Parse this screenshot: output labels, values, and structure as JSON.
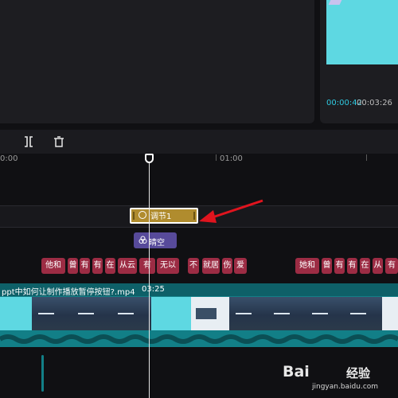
{
  "preview": {
    "current_time": "00:00:42",
    "total_time": "00:03:26"
  },
  "toolbar": {
    "split_icon": "split-icon",
    "delete_icon": "trash-icon"
  },
  "ruler": {
    "labels": [
      "0:00",
      "01:00"
    ]
  },
  "adjustment_clip": {
    "label": "调节1",
    "icon": "palette-icon"
  },
  "filter_clip": {
    "label": "晴空",
    "icon": "filter-icon"
  },
  "text_clips": [
    "他和",
    "曾",
    "有",
    "有",
    "在",
    "从云",
    "有",
    "无以",
    "不",
    "就居",
    "伤",
    "爱",
    "她和",
    "曾",
    "有",
    "有",
    "在",
    "从",
    "有"
  ],
  "video_clip": {
    "filename": "ppt中如何让制作播放暂停按钮?.mp4",
    "duration": "03:25"
  },
  "watermark": {
    "brand": "Bai",
    "brand_suffix": "经验",
    "url": "jingyan.baidu.com"
  },
  "colors": {
    "accent_time": "#2fc9e0",
    "adjust_clip": "#b08c2e",
    "filter_clip": "#574a9a",
    "text_clip": "#9c2c44",
    "video_track": "#127f87",
    "arrow": "#e0141e"
  }
}
